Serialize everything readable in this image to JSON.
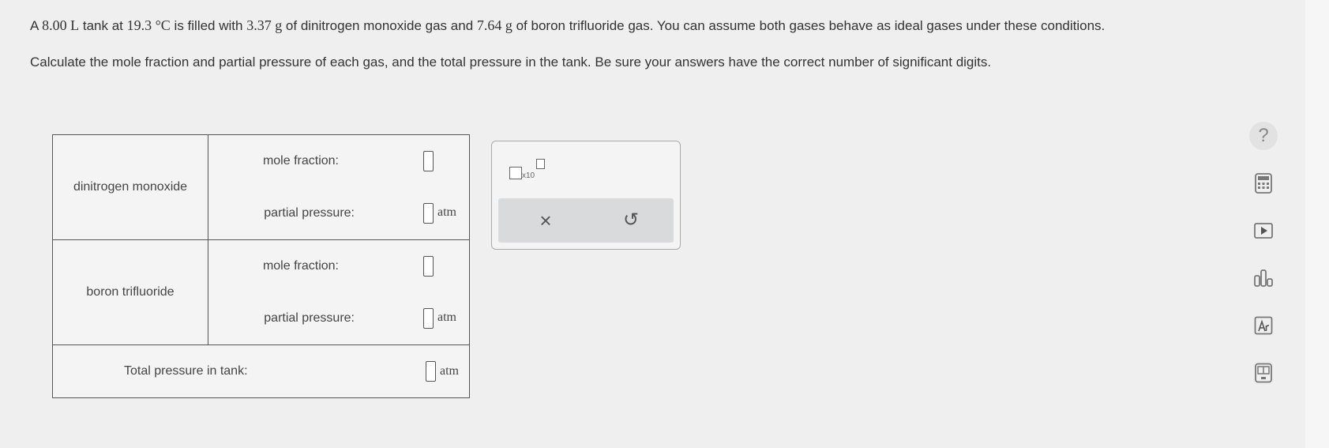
{
  "problem": {
    "p1_a": "A ",
    "volume": "8.00 L",
    "p1_b": " tank at ",
    "temperature": "19.3 °C",
    "p1_c": " is filled with ",
    "mass1": "3.37 g",
    "p1_d": " of dinitrogen monoxide gas and ",
    "mass2": "7.64 g",
    "p1_e": " of boron trifluoride gas. You can assume both gases behave as ideal gases under these conditions.",
    "p2": "Calculate the mole fraction and partial pressure of each gas, and the total pressure in the tank. Be sure your answers have the correct number of significant digits."
  },
  "table": {
    "rows": [
      {
        "gas": "dinitrogen monoxide",
        "mole_fraction_label": "mole fraction:",
        "partial_pressure_label": "partial pressure:",
        "unit": "atm"
      },
      {
        "gas": "boron trifluoride",
        "mole_fraction_label": "mole fraction:",
        "partial_pressure_label": "partial pressure:",
        "unit": "atm"
      }
    ],
    "total_label": "Total pressure in tank:",
    "total_unit": "atm"
  },
  "keypad": {
    "sci_notation": "x10",
    "clear_symbol": "×",
    "undo_symbol": "↺"
  },
  "toolbar": {
    "help_symbol": "?",
    "icons": [
      "calculator-icon",
      "video-icon",
      "chart-icon",
      "periodic-table-icon",
      "data-icon"
    ]
  }
}
